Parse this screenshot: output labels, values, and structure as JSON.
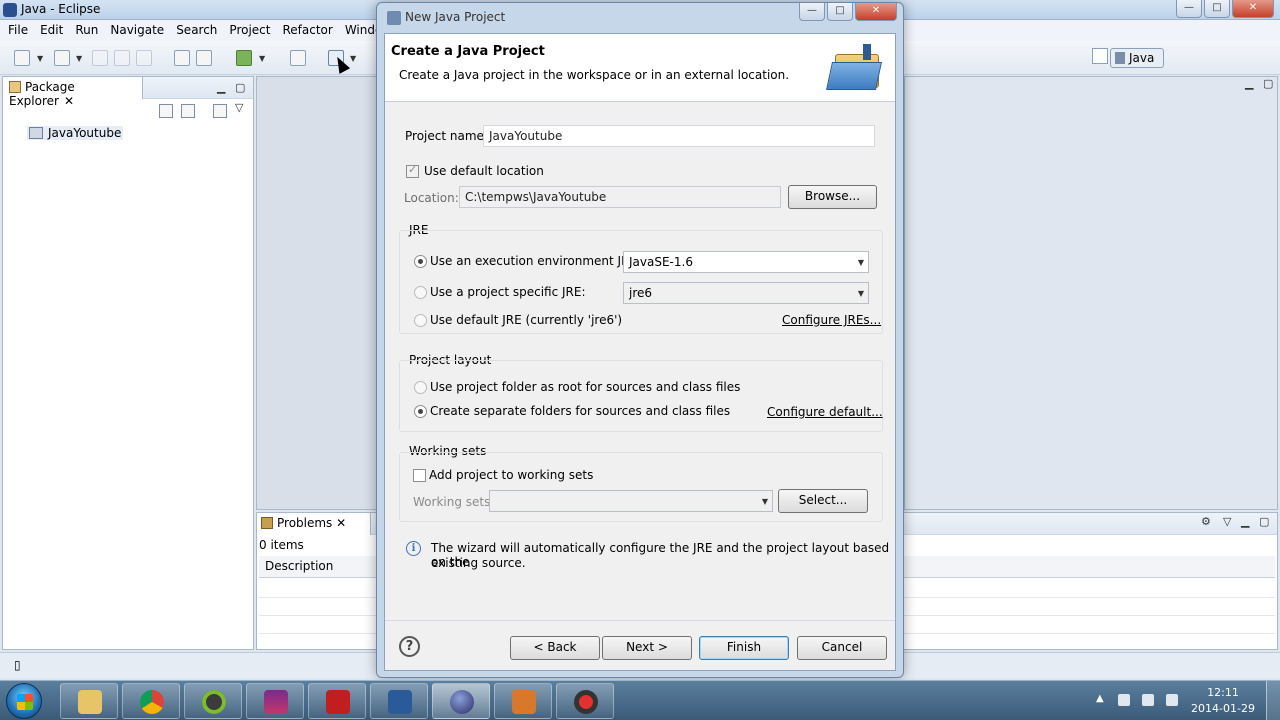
{
  "window": {
    "title": "Java - Eclipse",
    "menu": [
      "File",
      "Edit",
      "Run",
      "Navigate",
      "Search",
      "Project",
      "Refactor",
      "Window"
    ],
    "perspective": "Java"
  },
  "package_explorer": {
    "tab_label": "Package Explorer",
    "close_glyph": "✕",
    "items": [
      "JavaYoutube"
    ]
  },
  "problems": {
    "tab_label": "Problems",
    "close_glyph": "✕",
    "count": "0 items",
    "column": "Description"
  },
  "dialog": {
    "title": "New Java Project",
    "heading": "Create a Java Project",
    "subheading": "Create a Java project in the workspace or in an external location.",
    "project_name_label": "Project name:",
    "project_name_value": "JavaYoutube",
    "use_default_location_label": "Use default location",
    "use_default_location_checked": true,
    "location_label": "Location:",
    "location_value": "C:\\tempws\\JavaYoutube",
    "browse_label": "Browse...",
    "jre": {
      "group_title": "JRE",
      "opt_env_label": "Use an execution environment JRE:",
      "opt_env_value": "JavaSE-1.6",
      "opt_specific_label": "Use a project specific JRE:",
      "opt_specific_value": "jre6",
      "opt_default_label": "Use default JRE (currently 'jre6')",
      "configure_link": "Configure JREs...",
      "selected": "env"
    },
    "layout": {
      "group_title": "Project layout",
      "opt_root_label": "Use project folder as root for sources and class files",
      "opt_separate_label": "Create separate folders for sources and class files",
      "configure_link": "Configure default...",
      "selected": "separate"
    },
    "working_sets": {
      "group_title": "Working sets",
      "add_label": "Add project to working sets",
      "sets_label": "Working sets:",
      "select_label": "Select..."
    },
    "info_text_line1": "The wizard will automatically configure the JRE and the project layout based on the",
    "info_text_line2": "existing source.",
    "buttons": {
      "back": "< Back",
      "next": "Next >",
      "finish": "Finish",
      "cancel": "Cancel"
    }
  },
  "taskbar": {
    "time": "12:11",
    "date": "2014-01-29"
  }
}
